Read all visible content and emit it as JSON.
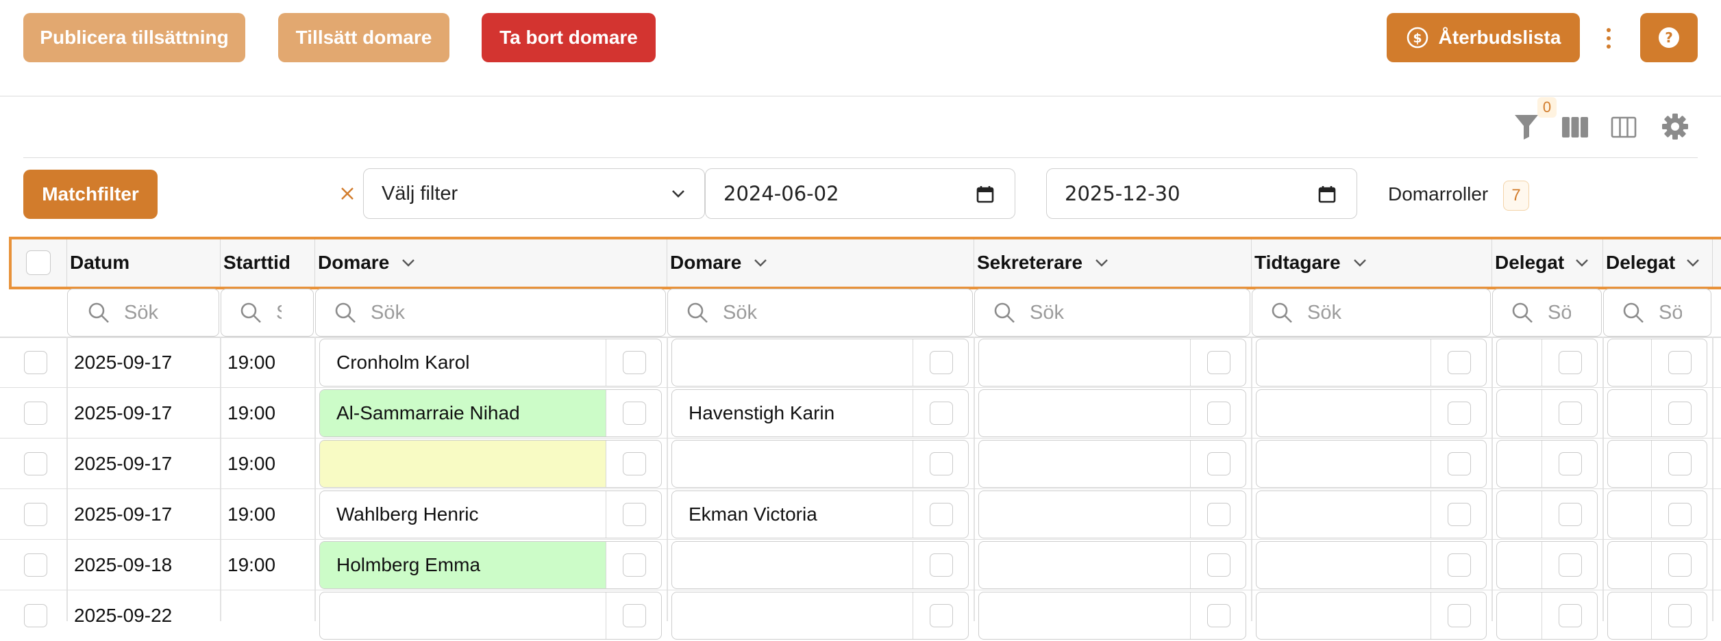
{
  "toolbar": {
    "publish_label": "Publicera tillsättning",
    "assign_label": "Tillsätt domare",
    "remove_label": "Ta bort domare",
    "cancellation_label": "Återbudslista"
  },
  "view_tools": {
    "filter_count": "0"
  },
  "filters": {
    "match_filter_label": "Matchfilter",
    "select_placeholder": "Välj filter",
    "date_from": "2024-06-02",
    "date_to": "2025-12-30",
    "roles_label": "Domarroller",
    "roles_count": "7"
  },
  "table": {
    "columns": [
      "Datum",
      "Starttid",
      "Domare",
      "Domare",
      "Sekreterare",
      "Tidtagare",
      "Delegat",
      "Delegat"
    ],
    "search_placeholder": "Sök",
    "rows": [
      {
        "date": "2025-09-17",
        "time": "19:00",
        "referee1": "Cronholm Karol",
        "referee2": ""
      },
      {
        "date": "2025-09-17",
        "time": "19:00",
        "referee1": "Al-Sammarraie Nihad",
        "referee2": "Havenstigh Karin"
      },
      {
        "date": "2025-09-17",
        "time": "19:00",
        "referee1": "",
        "referee2": ""
      },
      {
        "date": "2025-09-17",
        "time": "19:00",
        "referee1": "Wahlberg Henric",
        "referee2": "Ekman Victoria"
      },
      {
        "date": "2025-09-18",
        "time": "19:00",
        "referee1": "Holmberg Emma",
        "referee2": ""
      },
      {
        "date": "2025-09-22",
        "time": "",
        "referee1": "",
        "referee2": ""
      }
    ]
  },
  "colors": {
    "primary": "#D27C2C",
    "primary_light": "#E2A870",
    "danger": "#D33430",
    "highlight_border": "#E8923A",
    "cell_green": "#CCFCC8",
    "cell_yellow": "#F8FBC4"
  }
}
